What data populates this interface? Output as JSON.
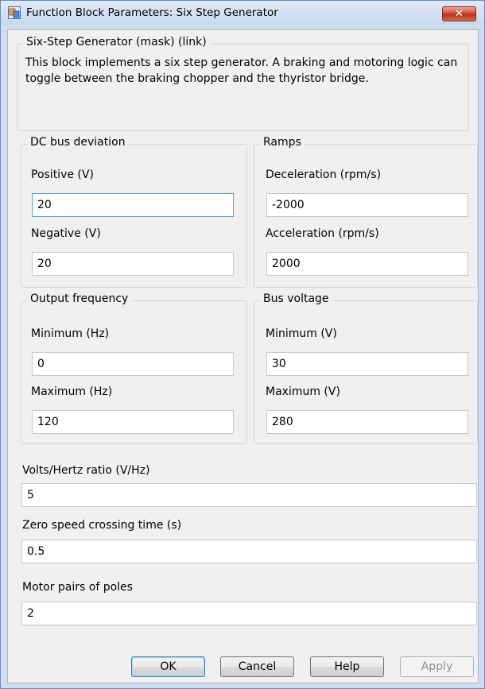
{
  "window": {
    "title": "Function Block Parameters: Six Step Generator",
    "close_icon": "close-icon"
  },
  "header": {
    "title": "Six-Step Generator (mask) (link)",
    "description": "This block implements a six step generator. A braking and motoring logic can toggle between the braking chopper and the thyristor bridge."
  },
  "dc_bus": {
    "title": "DC bus deviation",
    "positive_label": "Positive (V)",
    "positive_value": "20",
    "negative_label": "Negative (V)",
    "negative_value": "20"
  },
  "ramps": {
    "title": "Ramps",
    "decel_label": "Deceleration (rpm/s)",
    "decel_value": "-2000",
    "accel_label": "Acceleration (rpm/s)",
    "accel_value": "2000"
  },
  "output_freq": {
    "title": "Output frequency",
    "min_label": "Minimum (Hz)",
    "min_value": "0",
    "max_label": "Maximum (Hz)",
    "max_value": "120"
  },
  "bus_voltage": {
    "title": "Bus voltage",
    "min_label": "Minimum (V)",
    "min_value": "30",
    "max_label": "Maximum (V)",
    "max_value": "280"
  },
  "params": {
    "vhz_label": "Volts/Hertz ratio (V/Hz)",
    "vhz_value": "5",
    "zero_speed_label": "Zero speed crossing time (s)",
    "zero_speed_value": "0.5",
    "pole_pairs_label": "Motor pairs of poles",
    "pole_pairs_value": "2"
  },
  "buttons": {
    "ok": "OK",
    "cancel": "Cancel",
    "help": "Help",
    "apply": "Apply"
  },
  "colors": {
    "accent": "#3c7fb1",
    "close": "#c9452c",
    "focus": "#5a9ee0"
  }
}
